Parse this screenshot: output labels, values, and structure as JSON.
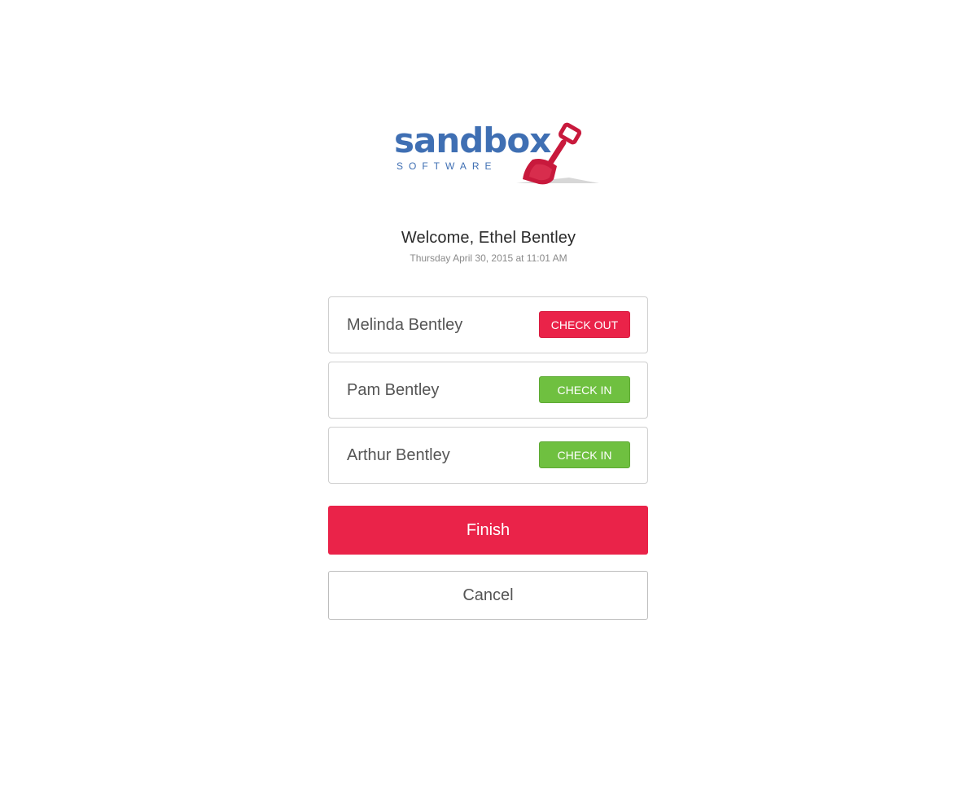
{
  "logo": {
    "wordmark": "sandbox",
    "subtitle": "SOFTWARE",
    "wordmark_color": "#3f6fb3",
    "shovel_color": "#c8193c"
  },
  "welcome": {
    "greeting": "Welcome, Ethel Bentley",
    "datetime": "Thursday April 30, 2015 at 11:01 AM"
  },
  "members": [
    {
      "name": "Melinda Bentley",
      "action": "CHECK OUT",
      "action_type": "check-out"
    },
    {
      "name": "Pam Bentley",
      "action": "CHECK IN",
      "action_type": "check-in"
    },
    {
      "name": "Arthur Bentley",
      "action": "CHECK IN",
      "action_type": "check-in"
    }
  ],
  "buttons": {
    "finish": "Finish",
    "cancel": "Cancel"
  },
  "colors": {
    "check_out": "#ea2349",
    "check_in": "#6fc040",
    "finish": "#ea2349"
  }
}
